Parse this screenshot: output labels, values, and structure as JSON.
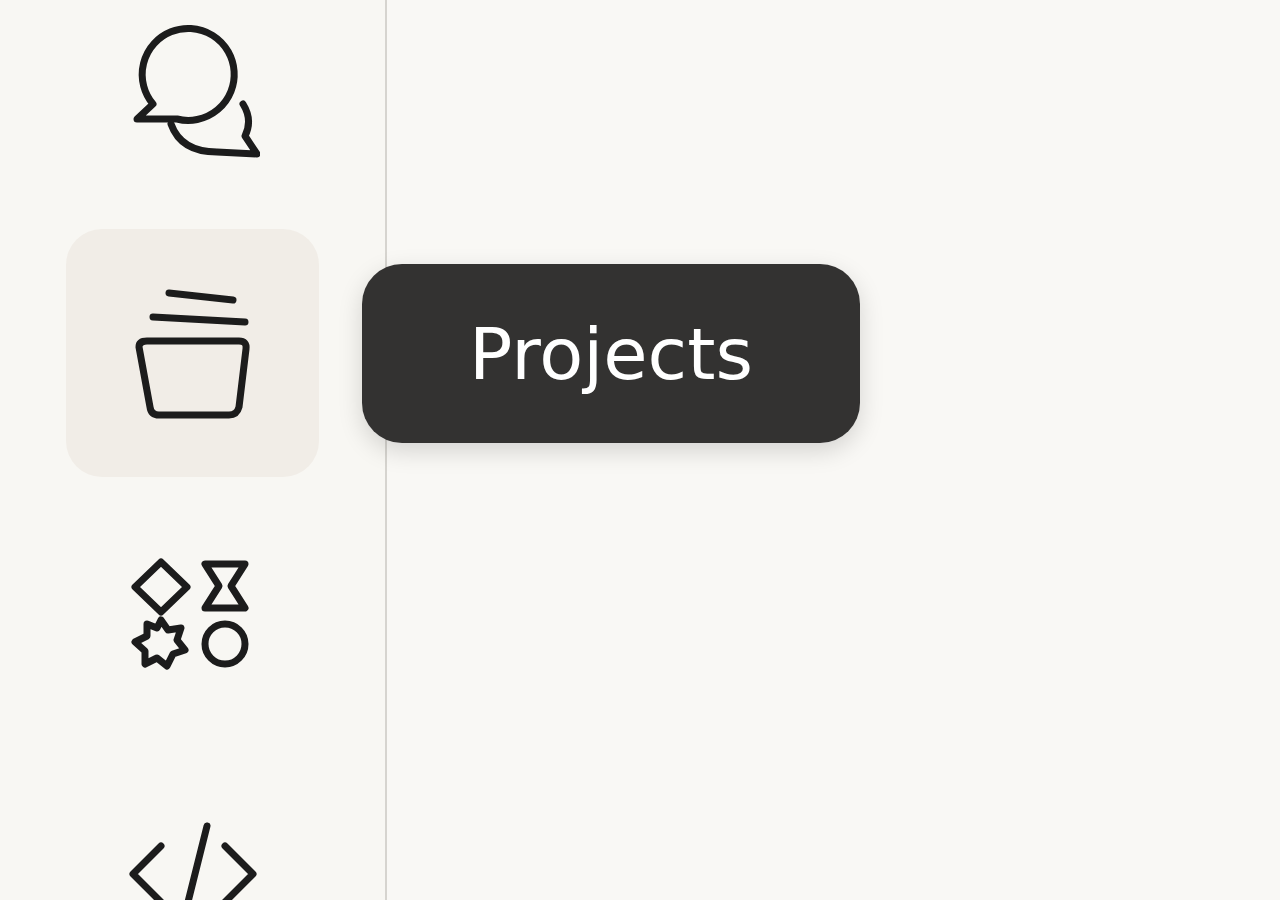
{
  "sidebar": {
    "items": [
      {
        "selected": false
      },
      {
        "selected": true
      },
      {
        "selected": false
      },
      {
        "selected": false
      }
    ]
  },
  "tooltip": {
    "text": "Projects"
  }
}
